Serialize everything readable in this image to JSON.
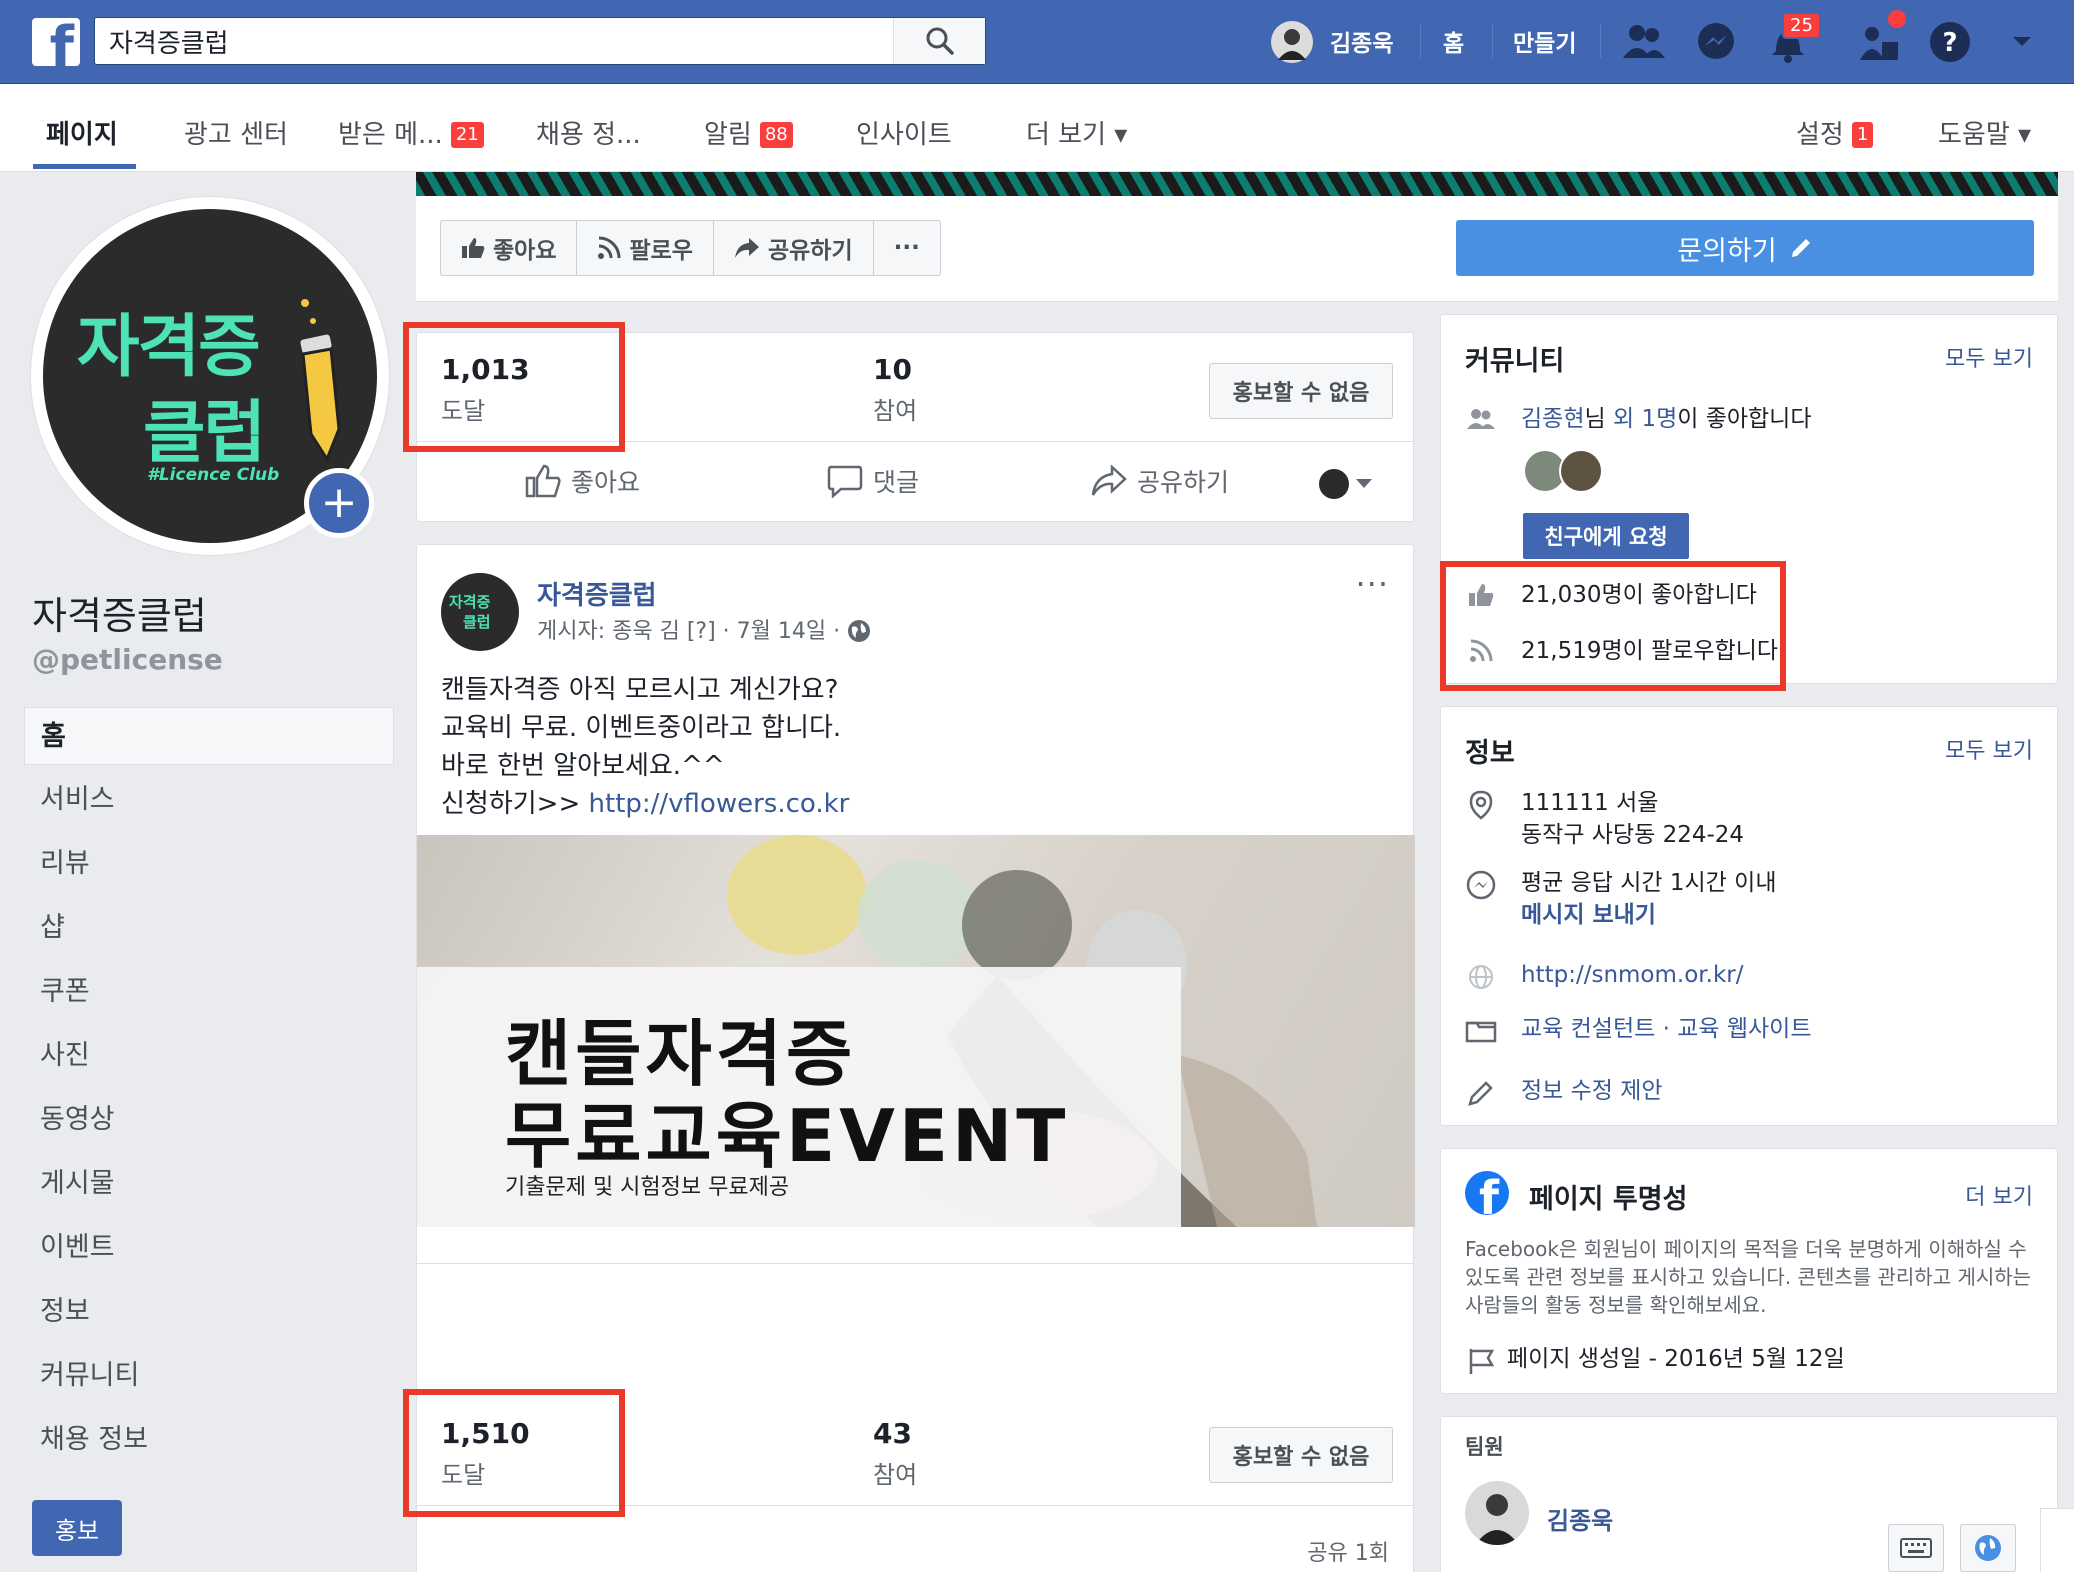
{
  "topbar": {
    "search_value": "자격증클럽",
    "user_name": "김종욱",
    "home": "홈",
    "create": "만들기",
    "notif_count": "25"
  },
  "page_nav": {
    "items": [
      {
        "label": "페이지"
      },
      {
        "label": "광고 센터"
      },
      {
        "label": "받은 메...",
        "badge": "21"
      },
      {
        "label": "채용 정..."
      },
      {
        "label": "알림",
        "badge": "88"
      },
      {
        "label": "인사이트"
      },
      {
        "label": "더 보기 ▾"
      }
    ],
    "settings": "설정",
    "settings_badge": "1",
    "help": "도움말 ▾"
  },
  "profile": {
    "logo_line1": "자격증",
    "logo_line2": "클럽",
    "logo_tag": "#Licence Club",
    "name": "자격증클럽",
    "handle": "@petlicense"
  },
  "left_nav": [
    "홈",
    "서비스",
    "리뷰",
    "샵",
    "쿠폰",
    "사진",
    "동영상",
    "게시물",
    "이벤트",
    "정보",
    "커뮤니티",
    "채용 정보"
  ],
  "promote_button": "홍보",
  "actions": {
    "like": "좋아요",
    "follow": "팔로우",
    "share": "공유하기",
    "more": "···",
    "contact": "문의하기"
  },
  "stats1": {
    "reach": "1,013",
    "reach_label": "도달",
    "engagement": "10",
    "engagement_label": "참여",
    "promo": "홍보할 수 없음"
  },
  "reactions": {
    "like": "좋아요",
    "comment": "댓글",
    "share": "공유하기"
  },
  "post": {
    "author": "자격증클럽",
    "meta": "게시자: 종욱 김 [?] · 7월 14일 ·",
    "lines": [
      "캔들자격증 아직 모르시고 계신가요?",
      "교육비 무료. 이벤트중이라고 합니다.",
      "바로 한번 알아보세요.^^"
    ],
    "cta_prefix": "신청하기>> ",
    "cta_link": "http://vflowers.co.kr",
    "image_title1": "캔들자격증",
    "image_title2": "무료교육EVENT",
    "image_sub": "기출문제 및 시험정보 무료제공"
  },
  "stats2": {
    "reach": "1,510",
    "reach_label": "도달",
    "engagement": "43",
    "engagement_label": "참여",
    "promo": "홍보할 수 없음",
    "shares": "공유 1회"
  },
  "community": {
    "title": "커뮤니티",
    "see_all": "모두 보기",
    "friend_name": "김종현",
    "friend_mid": "님 ",
    "friend_others": "외 1명",
    "friend_suffix": "이 좋아합니다",
    "invite": "친구에게 요청",
    "likes": "21,030명이 좋아합니다",
    "follows": "21,519명이 팔로우합니다"
  },
  "info": {
    "title": "정보",
    "see_all": "모두 보기",
    "address1": "111111 서울",
    "address2": "동작구 사당동 224-24",
    "response": "평균 응답 시간 1시간 이내",
    "message": "메시지 보내기",
    "website": "http://snmom.or.kr/",
    "categories": "교육 컨설턴트 · 교육 웹사이트",
    "suggest": "정보 수정 제안"
  },
  "transparency": {
    "title": "페이지 투명성",
    "more": "더 보기",
    "body": "Facebook은 회원님이 페이지의 목적을 더욱 분명하게 이해하실 수 있도록 관련 정보를 표시하고 있습니다. 콘텐츠를 관리하고 게시하는 사람들의 활동 정보를 확인해보세요.",
    "created": "페이지 생성일 - 2016년 5월 12일"
  },
  "team": {
    "title": "팀원",
    "member": "김종욱"
  },
  "colors": {
    "brand": "#4267b2",
    "highlight": "#e8392b",
    "logo_green": "#4de3b6"
  }
}
